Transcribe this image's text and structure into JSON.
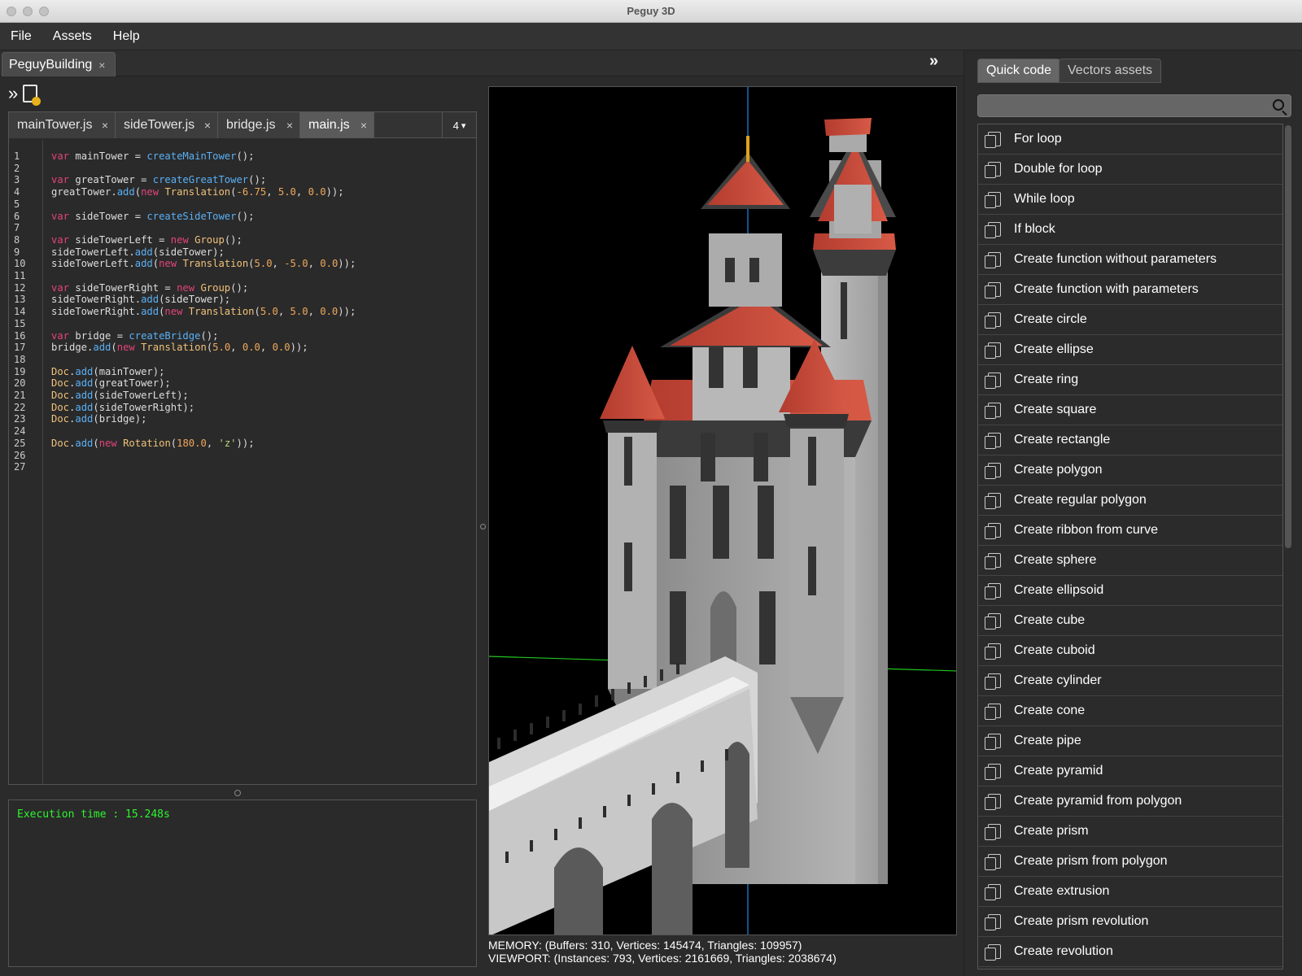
{
  "window": {
    "title": "Peguy 3D"
  },
  "menu": [
    "File",
    "Assets",
    "Help"
  ],
  "document_tab": {
    "label": "PeguyBuilding",
    "close": "×"
  },
  "editor": {
    "tabs": [
      {
        "label": "mainTower.js",
        "close": "×"
      },
      {
        "label": "sideTower.js",
        "close": "×"
      },
      {
        "label": "bridge.js",
        "close": "×"
      },
      {
        "label": "main.js",
        "close": "×"
      }
    ],
    "active_tab": "main.js",
    "hidden_tabs_count": "4",
    "line_numbers": [
      "1",
      "2",
      "3",
      "4",
      "5",
      "6",
      "7",
      "8",
      "9",
      "10",
      "11",
      "12",
      "13",
      "14",
      "15",
      "16",
      "17",
      "18",
      "19",
      "20",
      "21",
      "22",
      "23",
      "24",
      "25",
      "26",
      "27"
    ],
    "code_lines": [
      "var mainTower = createMainTower();",
      "",
      "var greatTower = createGreatTower();",
      "greatTower.add(new Translation(-6.75, 5.0, 0.0));",
      "",
      "var sideTower = createSideTower();",
      "",
      "var sideTowerLeft = new Group();",
      "sideTowerLeft.add(sideTower);",
      "sideTowerLeft.add(new Translation(5.0, -5.0, 0.0));",
      "",
      "var sideTowerRight = new Group();",
      "sideTowerRight.add(sideTower);",
      "sideTowerRight.add(new Translation(5.0, 5.0, 0.0));",
      "",
      "var bridge = createBridge();",
      "bridge.add(new Translation(5.0, 0.0, 0.0));",
      "",
      "Doc.add(mainTower);",
      "Doc.add(greatTower);",
      "Doc.add(sideTowerLeft);",
      "Doc.add(sideTowerRight);",
      "Doc.add(bridge);",
      "",
      "Doc.add(new Rotation(180.0, 'z'));",
      "",
      ""
    ]
  },
  "console": {
    "output": "Execution time : 15.248s"
  },
  "stats": {
    "memory": "MEMORY: (Buffers: 310, Vertices: 145474, Triangles: 109957)",
    "viewport": "VIEWPORT: (Instances: 793, Vertices: 2161669, Triangles: 2038674)"
  },
  "right_panel": {
    "tabs": [
      "Quick code",
      "Vectors assets"
    ],
    "active_tab": "Quick code",
    "search": {
      "placeholder": "",
      "value": ""
    },
    "items": [
      "For loop",
      "Double for loop",
      "While loop",
      "If block",
      "Create function without parameters",
      "Create function with parameters",
      "Create circle",
      "Create ellipse",
      "Create ring",
      "Create square",
      "Create rectangle",
      "Create polygon",
      "Create regular polygon",
      "Create ribbon from curve",
      "Create sphere",
      "Create ellipsoid",
      "Create cube",
      "Create cuboid",
      "Create cylinder",
      "Create cone",
      "Create pipe",
      "Create pyramid",
      "Create pyramid from polygon",
      "Create prism",
      "Create prism from polygon",
      "Create extrusion",
      "Create prism revolution",
      "Create revolution"
    ]
  },
  "icons": {
    "collapse": "chevrons-right-icon",
    "new_file": "new-file-icon",
    "search": "search-icon",
    "snippet": "copy-icon"
  },
  "colors": {
    "roof": "#c44a3a",
    "wall": "#a8a8a8",
    "console_text": "#2ef52e",
    "x_axis": "#1fc61f",
    "z_axis": "#1e88e5"
  }
}
